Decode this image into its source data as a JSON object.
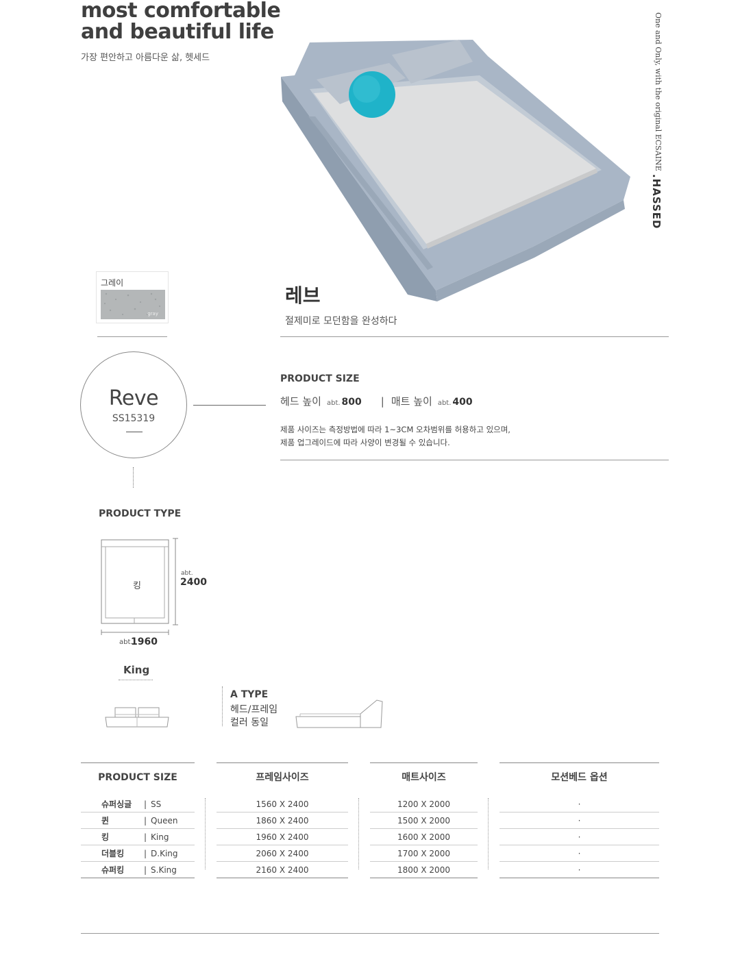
{
  "hero": {
    "title_line1": "most comfortable",
    "title_line2": "and beautiful life",
    "subtitle": "가장 편안하고 아름다운 삶, 헷세드"
  },
  "side": {
    "tagline": "One and Only, with the original ECSAINE",
    "brand": ".HASSED"
  },
  "color_swatch": {
    "label": "그레이",
    "swatch_text": "gray",
    "color": "#b4b7b8"
  },
  "product": {
    "name_ko": "레브",
    "tagline": "절제미로 모던함을 완성하다",
    "name_en": "Reve",
    "code": "SS15319"
  },
  "product_size": {
    "title": "PRODUCT SIZE",
    "head_label": "헤드 높이",
    "head_abt": "abt.",
    "head_value": "800",
    "separator": "|",
    "mat_label": "매트 높이",
    "mat_abt": "abt.",
    "mat_value": "400",
    "note_line1": "제품 사이즈는 측정방법에 따라 1~3CM 오차범위를 허용하고 있으며,",
    "note_line2": "제품 업그레이드에 따라 사양이 변경될 수 있습니다."
  },
  "product_type": {
    "title": "PRODUCT TYPE",
    "plan_label": "킹",
    "length_abt": "abt.",
    "length": "2400",
    "width_abt": "abt.",
    "width": "1960",
    "type_name": "King",
    "a_type_title": "A TYPE",
    "a_type_line1": "헤드/프레임",
    "a_type_line2": "컬러 동일"
  },
  "size_table": {
    "headers": [
      "PRODUCT SIZE",
      "프레임사이즈",
      "매트사이즈",
      "모션베드 옵션"
    ],
    "rows": [
      {
        "ko": "슈퍼싱글",
        "en": "SS",
        "frame": "1560 X 2400",
        "mat": "1200 X 2000",
        "motion": "·"
      },
      {
        "ko": "퀸",
        "en": "Queen",
        "frame": "1860 X 2400",
        "mat": "1500 X 2000",
        "motion": "·"
      },
      {
        "ko": "킹",
        "en": "King",
        "frame": "1960 X 2400",
        "mat": "1600 X 2000",
        "motion": "·"
      },
      {
        "ko": "더블킹",
        "en": "D.King",
        "frame": "2060 X 2400",
        "mat": "1700 X 2000",
        "motion": "·"
      },
      {
        "ko": "슈퍼킹",
        "en": "S.King",
        "frame": "2160 X 2400",
        "mat": "1800 X 2000",
        "motion": "·"
      }
    ]
  },
  "colors": {
    "bed_frame": "#a9b6c6",
    "mattress": "#dedfe0",
    "pillow": "#1fb3c9"
  }
}
